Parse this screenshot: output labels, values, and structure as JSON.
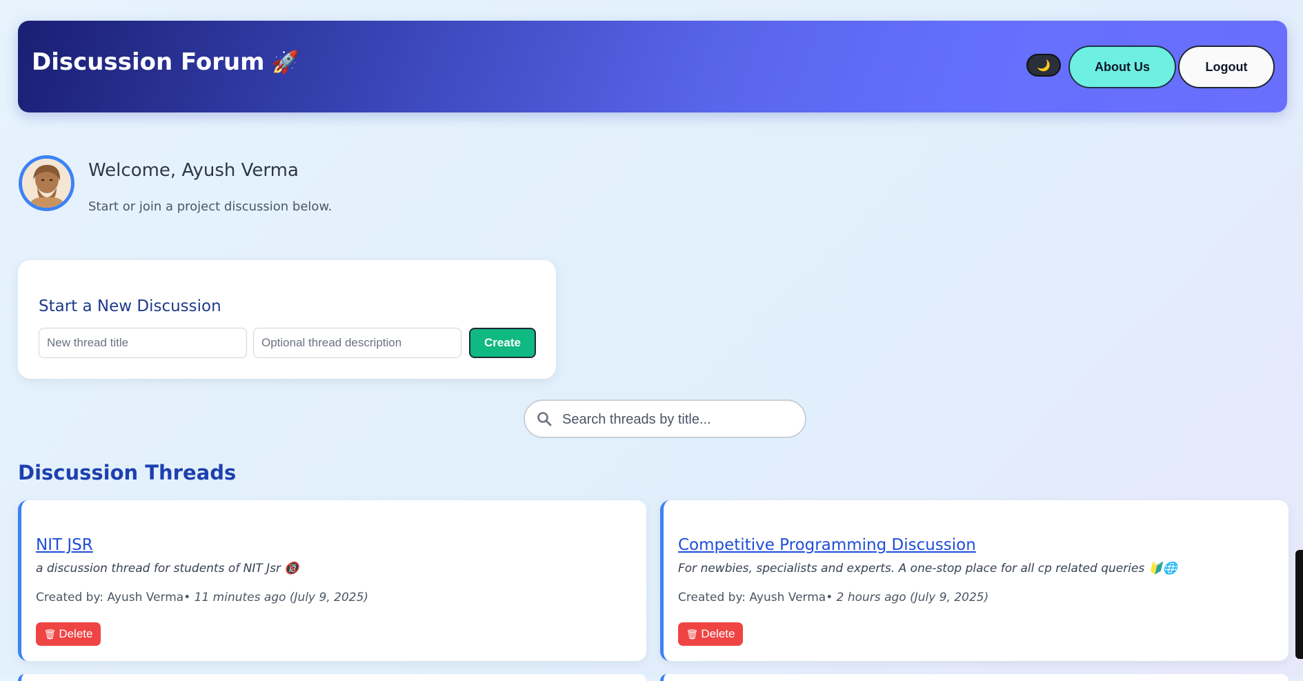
{
  "header": {
    "title": "Discussion Forum",
    "title_emoji": "🚀",
    "theme_toggle_icon": "🌙",
    "about_label": "About Us",
    "logout_label": "Logout"
  },
  "user": {
    "welcome": "Welcome, Ayush Verma",
    "subtext": "Start or join a project discussion below."
  },
  "new_thread": {
    "heading": "Start a New Discussion",
    "title_placeholder": "New thread title",
    "desc_placeholder": "Optional thread description",
    "create_label": "Create"
  },
  "search": {
    "placeholder": "Search threads by title..."
  },
  "threads_section": {
    "heading": "Discussion Threads",
    "threads": [
      {
        "title": "NIT JSR",
        "description": "a discussion thread for students of NIT Jsr 🔞",
        "created_by": "Created by: Ayush Verma",
        "time": "• 11 minutes ago (July 9, 2025)",
        "delete_label": "Delete"
      },
      {
        "title": "Competitive Programming Discussion",
        "description": "For newbies, specialists and experts. A one-stop place for all cp related queries 🔰🌐",
        "created_by": "Created by: Ayush Verma",
        "time": "• 2 hours ago (July 9, 2025)",
        "delete_label": "Delete"
      }
    ]
  },
  "colors": {
    "accent": "#3b82f6",
    "create": "#10b981",
    "delete": "#ef4444",
    "about": "#6df0e1"
  }
}
